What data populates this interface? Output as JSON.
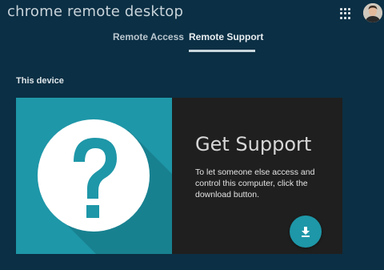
{
  "header": {
    "app_title": "chrome remote desktop",
    "apps_icon": "apps-grid-icon",
    "avatar_icon": "user-avatar"
  },
  "tabs": [
    {
      "label": "Remote Access",
      "selected": false
    },
    {
      "label": "Remote Support",
      "selected": true
    }
  ],
  "section": {
    "label": "This device"
  },
  "card": {
    "title": "Get Support",
    "description": "To let someone else access and control this computer, click the download button.",
    "illustration_icon": "question-mark-icon",
    "download_icon": "download-icon",
    "colors": {
      "accent": "#1e97a8",
      "panel": "#1f1f1f",
      "background": "#0b2f44"
    }
  }
}
